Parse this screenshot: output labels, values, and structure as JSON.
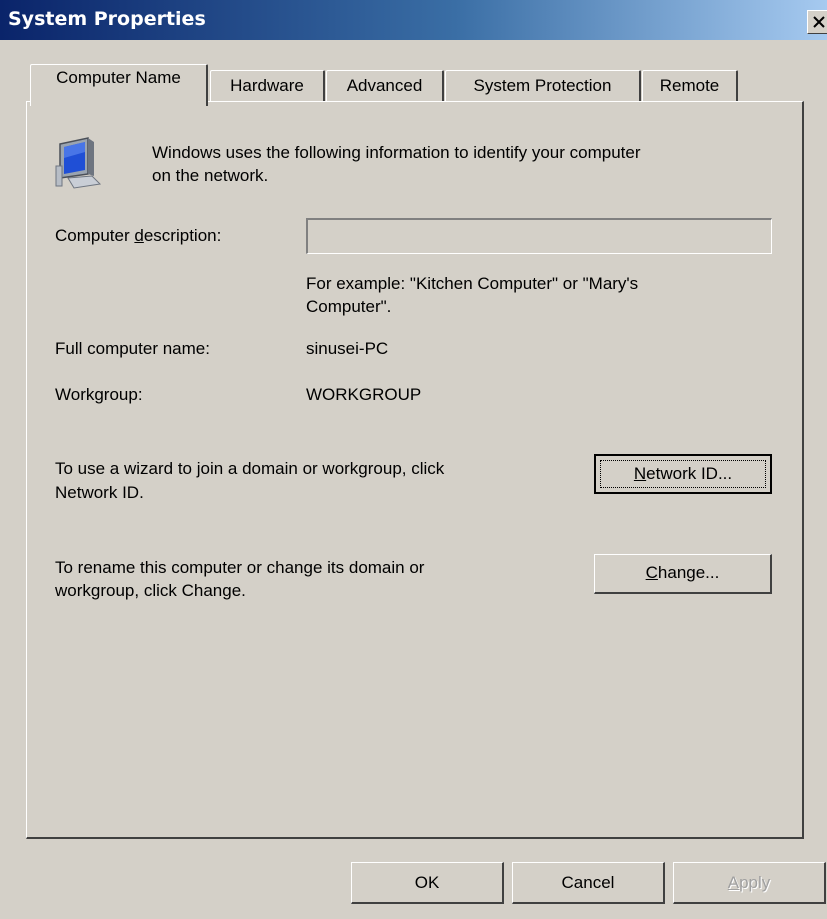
{
  "window": {
    "title": "System Properties",
    "close_label": "×"
  },
  "tabs": [
    {
      "label": "Computer Name",
      "active": true
    },
    {
      "label": "Hardware",
      "active": false
    },
    {
      "label": "Advanced",
      "active": false
    },
    {
      "label": "System Protection",
      "active": false
    },
    {
      "label": "Remote",
      "active": false
    }
  ],
  "intro": {
    "icon": "computer-monitor-icon",
    "line1": "Windows uses the following information to identify your computer",
    "line2": "on the network."
  },
  "description": {
    "label_pre": "Computer ",
    "label_accel": "d",
    "label_post": "escription:",
    "value": "",
    "hint_line1": "For example: \"Kitchen Computer\" or \"Mary's",
    "hint_line2": "Computer\"."
  },
  "full_name": {
    "label": "Full computer name:",
    "value": "sinusei-PC"
  },
  "workgroup": {
    "label": "Workgroup:",
    "value": "WORKGROUP"
  },
  "network_id": {
    "text_line1": "To use a wizard to join a domain or workgroup, click",
    "text_line2": "Network ID.",
    "button_accel": "N",
    "button_rest": "etwork ID..."
  },
  "change": {
    "text_line1": "To rename this computer or change its domain or",
    "text_line2": "workgroup, click Change.",
    "button_accel": "C",
    "button_rest": "hange..."
  },
  "footer": {
    "ok_label": "OK",
    "cancel_label": "Cancel",
    "apply_accel": "A",
    "apply_rest": "pply"
  }
}
